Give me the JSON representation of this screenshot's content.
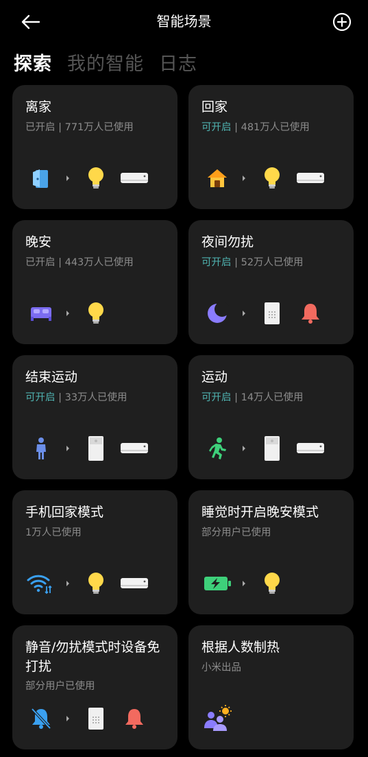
{
  "header": {
    "title": "智能场景",
    "back_icon": "back-arrow-icon",
    "add_icon": "add-circle-icon"
  },
  "tabs": [
    {
      "label": "探索",
      "active": true
    },
    {
      "label": "我的智能",
      "active": false
    },
    {
      "label": "日志",
      "active": false
    }
  ],
  "cards": [
    {
      "title": "离家",
      "status": "已开启",
      "usage": "771万人已使用",
      "icons": [
        "door-icon",
        "bulb-icon",
        "air-conditioner-icon"
      ]
    },
    {
      "title": "回家",
      "status": "可开启",
      "usage": "481万人已使用",
      "icons": [
        "home-icon",
        "bulb-icon",
        "air-conditioner-icon"
      ]
    },
    {
      "title": "晚安",
      "status": "已开启",
      "usage": "443万人已使用",
      "icons": [
        "bed-icon",
        "bulb-icon"
      ]
    },
    {
      "title": "夜间勿扰",
      "status": "可开启",
      "usage": "52万人已使用",
      "icons": [
        "moon-icon",
        "speaker-icon",
        "bell-icon"
      ]
    },
    {
      "title": "结束运动",
      "status": "可开启",
      "usage": "33万人已使用",
      "icons": [
        "person-icon",
        "air-purifier-icon",
        "air-conditioner-icon"
      ]
    },
    {
      "title": "运动",
      "status": "可开启",
      "usage": "14万人已使用",
      "icons": [
        "running-icon",
        "air-purifier-icon",
        "air-conditioner-icon"
      ]
    },
    {
      "title": "手机回家模式",
      "status": "",
      "usage": "1万人已使用",
      "icons": [
        "wifi-icon",
        "bulb-icon",
        "air-conditioner-icon"
      ]
    },
    {
      "title": "睡觉时开启晚安模式",
      "status": "",
      "usage": "部分用户已使用",
      "icons": [
        "battery-charging-icon",
        "bulb-icon"
      ]
    },
    {
      "title": "静音/勿扰模式时设备免打扰",
      "status": "",
      "usage": "部分用户已使用",
      "icons": [
        "mute-bell-icon",
        "speaker-icon",
        "bell-icon"
      ]
    },
    {
      "title": "根据人数制热",
      "status": "",
      "usage": "小米出品",
      "icons": [
        "people-sun-icon"
      ]
    }
  ],
  "colors": {
    "background": "#000000",
    "card": "#1f1f1f",
    "accent_teal": "#4fb3b1",
    "muted_text": "#8c8c8c"
  }
}
